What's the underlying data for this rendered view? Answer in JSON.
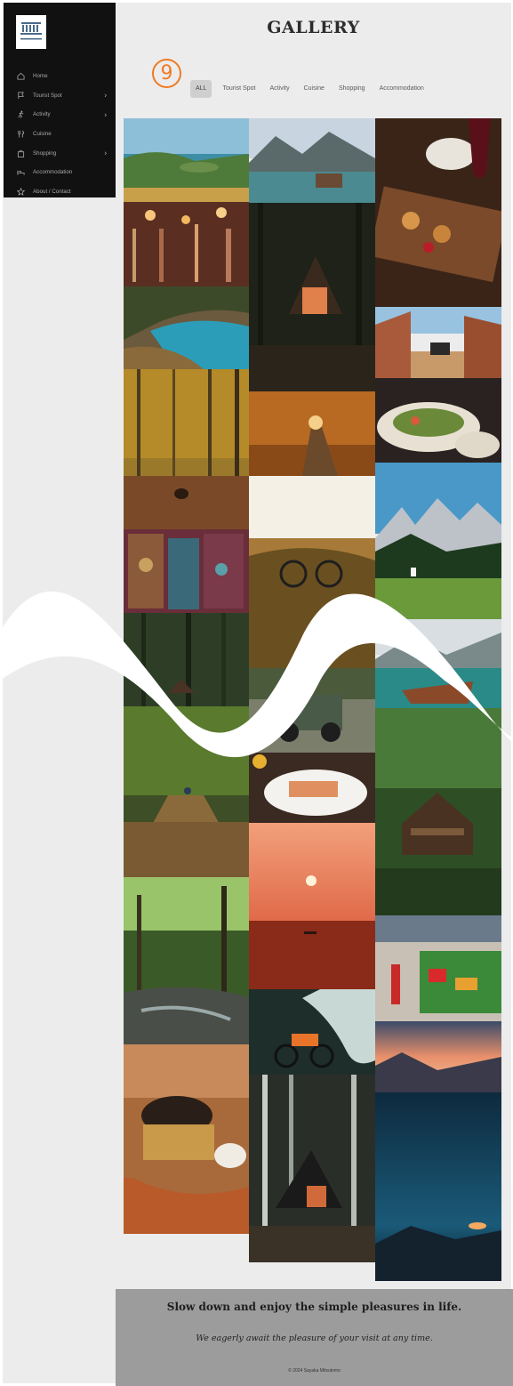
{
  "sidebar": {
    "items": [
      {
        "label": "Home",
        "icon": "home-icon",
        "has_submenu": false
      },
      {
        "label": "Tourist Spot",
        "icon": "flag-icon",
        "has_submenu": true
      },
      {
        "label": "Activity",
        "icon": "running-icon",
        "has_submenu": true
      },
      {
        "label": "Cuisine",
        "icon": "utensils-icon",
        "has_submenu": false
      },
      {
        "label": "Shopping",
        "icon": "shopping-bag-icon",
        "has_submenu": true
      },
      {
        "label": "Accommodation",
        "icon": "bed-icon",
        "has_submenu": false
      },
      {
        "label": "About / Contact",
        "icon": "star-icon",
        "has_submenu": false
      }
    ],
    "chevron": "›"
  },
  "header": {
    "title": "GALLERY",
    "count_badge": "9"
  },
  "filters": {
    "items": [
      "ALL",
      "Tourist Spot",
      "Activity",
      "Cuisine",
      "Shopping",
      "Accommodation"
    ],
    "active": "ALL"
  },
  "gallery": {
    "photos": [
      {
        "subject": "lake-with-island"
      },
      {
        "subject": "mountain-lake-boathouse"
      },
      {
        "subject": "food-board-wine"
      },
      {
        "subject": "market-lights"
      },
      {
        "subject": "a-frame-cabin-night"
      },
      {
        "subject": "coastal-cove"
      },
      {
        "subject": "canyon-jeep"
      },
      {
        "subject": "autumn-forest-dog"
      },
      {
        "subject": "autumn-road"
      },
      {
        "subject": "salad-plate"
      },
      {
        "subject": "bicycle-sunset"
      },
      {
        "subject": "alpine-church"
      },
      {
        "subject": "market-goods"
      },
      {
        "subject": "forest-cabin"
      },
      {
        "subject": "mountain-lake-boat"
      },
      {
        "subject": "offroad-jeep"
      },
      {
        "subject": "forest-cyclist"
      },
      {
        "subject": "salmon-dish"
      },
      {
        "subject": "lakeside-lodge"
      },
      {
        "subject": "sea-sunset-kayak"
      },
      {
        "subject": "forest-stream"
      },
      {
        "subject": "market-stall"
      },
      {
        "subject": "motocross-splash"
      },
      {
        "subject": "cloud-sea-sunrise"
      },
      {
        "subject": "burger-fries"
      },
      {
        "subject": "a-frame-forest"
      },
      {
        "subject": "night-sky-mountain"
      }
    ]
  },
  "footer": {
    "tagline": "Slow down and enjoy the simple pleasures in life.",
    "subline": "We eagerly await the pleasure of your visit at any time.",
    "copyright": "© 2024 Sayaka Mitsutomo"
  },
  "colors": {
    "accent": "#f07a22",
    "sidebar_bg": "#111111",
    "footer_bg": "#9c9c9c",
    "page_bg": "#ececec"
  }
}
